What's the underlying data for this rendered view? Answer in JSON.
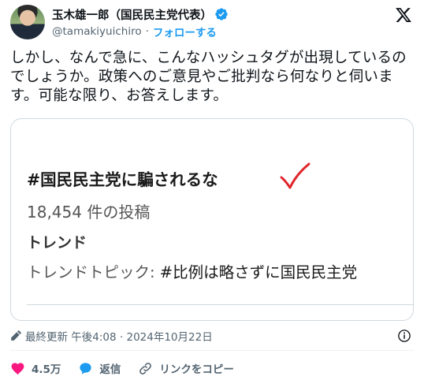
{
  "author": {
    "display_name": "玉木雄一郎（国民民主党代表）",
    "handle": "@tamakiyuichiro",
    "separator": "·",
    "follow_label": "フォローする"
  },
  "tweet": {
    "text": "しかし、なんで急に、こんなハッシュタグが出現しているのでしょうか。政策へのご意見やご批判なら何なりと伺います。可能な限り、お答えします。"
  },
  "media": {
    "title": "#国民民主党に騙されるな",
    "count": "18,454 件の投稿",
    "trend_label": "トレンド",
    "trend_prefix": "トレンドトピック: ",
    "trend_hashtag": "#比例は略さずに国民民主党"
  },
  "meta": {
    "updated_label": "最終更新 午後4:08 · 2024年10月22日"
  },
  "actions": {
    "likes": "4.5万",
    "reply": "返信",
    "copy_link": "リンクをコピー"
  },
  "colors": {
    "accent": "#1d9bf0",
    "like": "#f91880",
    "check_red": "#e0262b"
  }
}
